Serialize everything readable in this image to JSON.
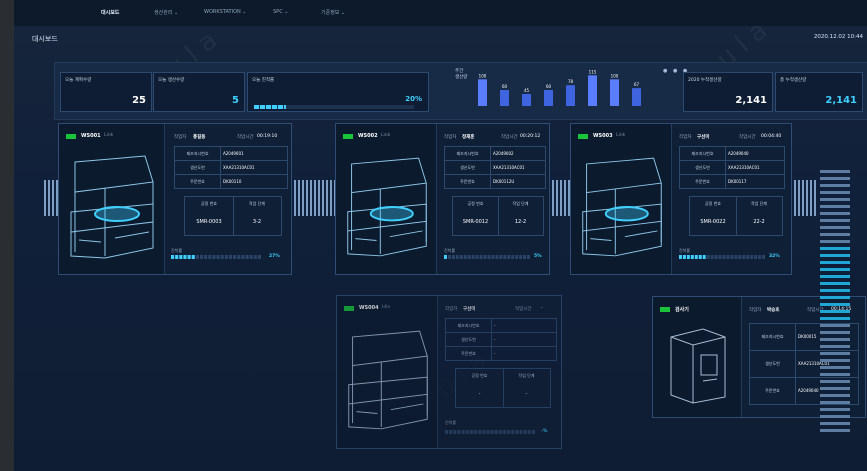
{
  "nav": {
    "items": [
      "대시보드",
      "생산관리",
      "WORKSTATION",
      "SPC",
      "기준정보"
    ],
    "active_index": 0
  },
  "header": {
    "title": "대시보드",
    "datetime": "2020.12.02 10:44"
  },
  "kpis": {
    "target_today": {
      "label": "오늘 계획수량",
      "value": "25"
    },
    "produced_today": {
      "label": "오늘 생산수량",
      "value": "5"
    },
    "achievement": {
      "label": "오늘 진척률",
      "value": "20%",
      "fraction": 0.2
    },
    "weekly_production": {
      "label_line1": "주간",
      "label_line2": "생산량"
    },
    "year_total": {
      "label": "2020 누적생산량",
      "value": "2,141"
    },
    "all_total": {
      "label": "총 누적생산량",
      "value": "2,141"
    }
  },
  "chart_data": {
    "type": "bar",
    "categories": [
      "",
      "",
      "",
      "",
      "",
      "",
      "",
      ""
    ],
    "values": [
      100,
      60,
      45,
      60,
      78,
      115,
      100,
      67
    ],
    "data_labels": [
      "100",
      "60",
      "45",
      "60",
      "78",
      "115",
      "100",
      "67"
    ]
  },
  "workstations": [
    {
      "id": "WS001",
      "state": "Link",
      "state_color": "#19c43a",
      "worker_label": "작업자",
      "worker": "홍길동",
      "time_label": "작업시간",
      "time": "00:19:10",
      "rows": [
        {
          "key": "제조지시번호",
          "value": "A2049001"
        },
        {
          "key": "생산도번",
          "value": "XAA21310AC01"
        },
        {
          "key": "주문번호",
          "value": "DK00110"
        }
      ],
      "sub_heads": [
        "공정 번호",
        "작업 단계"
      ],
      "sub_values": [
        "SMR-0003",
        "3-2"
      ],
      "progress_label": "진척률",
      "progress_pct": "27%",
      "progress_fraction": 0.27
    },
    {
      "id": "WS002",
      "state": "Link",
      "state_color": "#19c43a",
      "worker_label": "작업자",
      "worker": "정재훈",
      "time_label": "작업시간",
      "time": "00:20:12",
      "rows": [
        {
          "key": "제조지시번호",
          "value": "A2049002"
        },
        {
          "key": "생산도번",
          "value": "XAA21310AC01"
        },
        {
          "key": "주문번호",
          "value": "DK00112U"
        }
      ],
      "sub_heads": [
        "공정 번호",
        "작업 단계"
      ],
      "sub_values": [
        "SMR-0012",
        "12-2"
      ],
      "progress_label": "진척률",
      "progress_pct": "5%",
      "progress_fraction": 0.05
    },
    {
      "id": "WS003",
      "state": "Link",
      "state_color": "#19c43a",
      "worker_label": "작업자",
      "worker": "구선미",
      "time_label": "작업시간",
      "time": "00:04:40",
      "rows": [
        {
          "key": "제조지시번호",
          "value": "A2049040"
        },
        {
          "key": "생산도번",
          "value": "XAA21310AC01"
        },
        {
          "key": "주문번호",
          "value": "DK00117"
        }
      ],
      "sub_heads": [
        "공정 번호",
        "작업 단계"
      ],
      "sub_values": [
        "SMR-0022",
        "22-2"
      ],
      "progress_label": "진척률",
      "progress_pct": "32%",
      "progress_fraction": 0.32
    },
    {
      "id": "WS004",
      "state": "Idle",
      "state_color": "#19c43a",
      "worker_label": "작업자",
      "worker": "구선미",
      "time_label": "작업시간",
      "time": "-",
      "rows": [
        {
          "key": "제조지시번호",
          "value": "-"
        },
        {
          "key": "생산도번",
          "value": "-"
        },
        {
          "key": "주문번호",
          "value": "-"
        }
      ],
      "sub_heads": [
        "공정 번호",
        "작업 단계"
      ],
      "sub_values": [
        "-",
        "-"
      ],
      "progress_label": "진척률",
      "progress_pct": "-%",
      "progress_fraction": 0
    }
  ],
  "inspector": {
    "title": "검사기",
    "state_color": "#19c43a",
    "worker_label": "작업자",
    "worker": "박승호",
    "time_label": "작업시간",
    "time": "00:14:15",
    "rows": [
      {
        "key": "제조지시번호",
        "value": "DK00015"
      },
      {
        "key": "생산도번",
        "value": "XAA21310AC01"
      },
      {
        "key": "주문번호",
        "value": "A2049040"
      }
    ]
  },
  "colors": {
    "accent": "#3fd0ff",
    "status_ok": "#19c43a",
    "panel": "#0f1f36",
    "border": "#2d4d76"
  },
  "icons": {
    "carousel": "carousel-dots-icon"
  }
}
